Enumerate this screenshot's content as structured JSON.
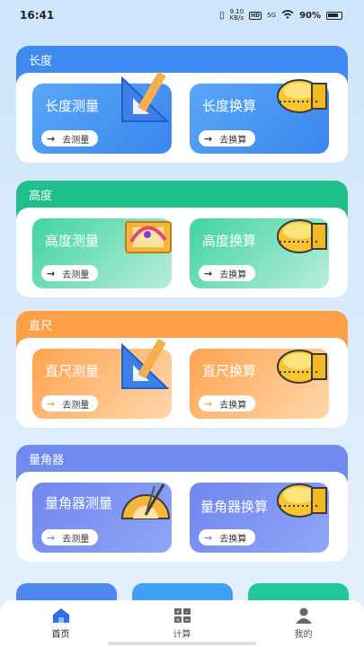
{
  "status": {
    "time": "16:41",
    "net_speed_top": "9.10",
    "net_speed_bottom": "KB/s",
    "hd": "HD",
    "net_type": "5G",
    "battery": "90%"
  },
  "sections": [
    {
      "title": "长度",
      "color": "#3d8bf2",
      "left_card": {
        "title": "长度测量",
        "button": "去测量"
      },
      "right_card": {
        "title": "长度换算",
        "button": "去换算"
      }
    },
    {
      "title": "高度",
      "color": "#1fbf8c",
      "left_card": {
        "title": "高度测量",
        "button": "去测量"
      },
      "right_card": {
        "title": "高度换算",
        "button": "去换算"
      }
    },
    {
      "title": "直尺",
      "color": "#ff9f48",
      "left_card": {
        "title": "直尺测量",
        "button": "去测量"
      },
      "right_card": {
        "title": "直尺换算",
        "button": "去换算"
      }
    },
    {
      "title": "量角器",
      "color": "#6f8bf0",
      "left_card": {
        "title": "量角器测量",
        "button": "去测量"
      },
      "right_card": {
        "title": "量角器换算",
        "button": "去换算"
      }
    }
  ],
  "tabs": [
    {
      "label": "首页",
      "icon": "home-icon",
      "active": true
    },
    {
      "label": "计算",
      "icon": "calculator-icon",
      "active": false
    },
    {
      "label": "我的",
      "icon": "user-icon",
      "active": false
    }
  ]
}
